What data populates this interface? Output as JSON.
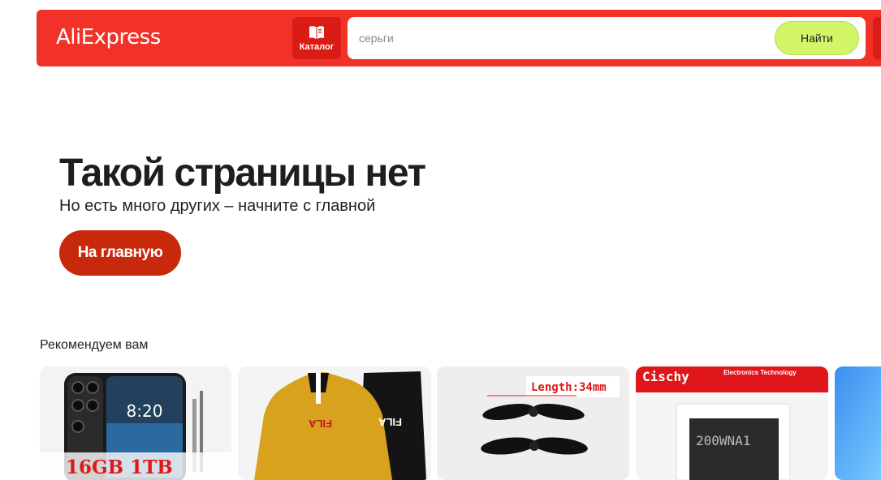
{
  "header": {
    "logo": "AliExpress",
    "catalog_label": "Каталог",
    "search_placeholder": "серьги",
    "search_button": "Найти",
    "colors": {
      "header_bg": "#f23128",
      "search_button_bg": "#d2f668"
    }
  },
  "error": {
    "title": "Такой страницы нет",
    "subtitle": "Но есть много других – начните с главной",
    "home_button": "На главную",
    "button_color": "#c8290c"
  },
  "recommendations": {
    "title": "Рекомендуем вам",
    "products": [
      {
        "image_text": [
          "8:20",
          "16GB 1TB"
        ],
        "icon": "smartphone-image"
      },
      {
        "image_text": [
          "FILA"
        ],
        "icon": "tracksuit-image"
      },
      {
        "image_text": [
          "Length:34mm"
        ],
        "icon": "propeller-image"
      },
      {
        "image_text": [
          "Cischy",
          "Electronics Technology",
          "200WNA1"
        ],
        "icon": "chip-image"
      },
      {
        "image_text": [],
        "icon": "product-image"
      }
    ]
  }
}
